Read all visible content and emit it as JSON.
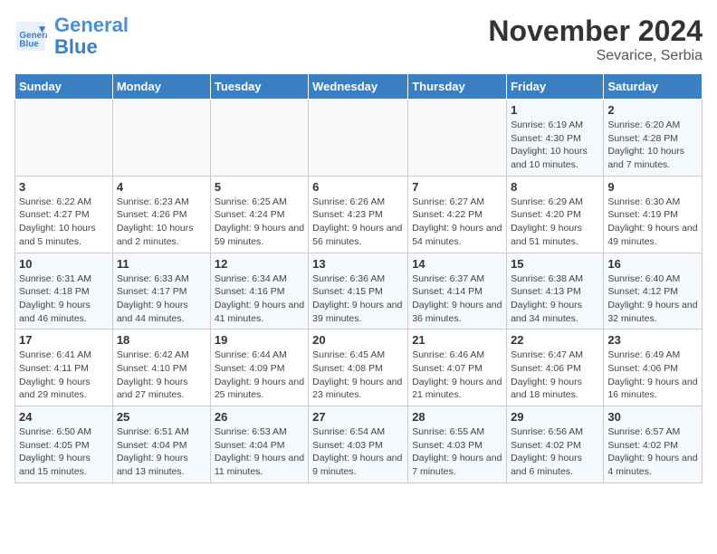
{
  "header": {
    "logo_line1": "General",
    "logo_line2": "Blue",
    "month": "November 2024",
    "location": "Sevarice, Serbia"
  },
  "weekdays": [
    "Sunday",
    "Monday",
    "Tuesday",
    "Wednesday",
    "Thursday",
    "Friday",
    "Saturday"
  ],
  "weeks": [
    [
      {
        "day": "",
        "info": ""
      },
      {
        "day": "",
        "info": ""
      },
      {
        "day": "",
        "info": ""
      },
      {
        "day": "",
        "info": ""
      },
      {
        "day": "",
        "info": ""
      },
      {
        "day": "1",
        "info": "Sunrise: 6:19 AM\nSunset: 4:30 PM\nDaylight: 10 hours and 10 minutes."
      },
      {
        "day": "2",
        "info": "Sunrise: 6:20 AM\nSunset: 4:28 PM\nDaylight: 10 hours and 7 minutes."
      }
    ],
    [
      {
        "day": "3",
        "info": "Sunrise: 6:22 AM\nSunset: 4:27 PM\nDaylight: 10 hours and 5 minutes."
      },
      {
        "day": "4",
        "info": "Sunrise: 6:23 AM\nSunset: 4:26 PM\nDaylight: 10 hours and 2 minutes."
      },
      {
        "day": "5",
        "info": "Sunrise: 6:25 AM\nSunset: 4:24 PM\nDaylight: 9 hours and 59 minutes."
      },
      {
        "day": "6",
        "info": "Sunrise: 6:26 AM\nSunset: 4:23 PM\nDaylight: 9 hours and 56 minutes."
      },
      {
        "day": "7",
        "info": "Sunrise: 6:27 AM\nSunset: 4:22 PM\nDaylight: 9 hours and 54 minutes."
      },
      {
        "day": "8",
        "info": "Sunrise: 6:29 AM\nSunset: 4:20 PM\nDaylight: 9 hours and 51 minutes."
      },
      {
        "day": "9",
        "info": "Sunrise: 6:30 AM\nSunset: 4:19 PM\nDaylight: 9 hours and 49 minutes."
      }
    ],
    [
      {
        "day": "10",
        "info": "Sunrise: 6:31 AM\nSunset: 4:18 PM\nDaylight: 9 hours and 46 minutes."
      },
      {
        "day": "11",
        "info": "Sunrise: 6:33 AM\nSunset: 4:17 PM\nDaylight: 9 hours and 44 minutes."
      },
      {
        "day": "12",
        "info": "Sunrise: 6:34 AM\nSunset: 4:16 PM\nDaylight: 9 hours and 41 minutes."
      },
      {
        "day": "13",
        "info": "Sunrise: 6:36 AM\nSunset: 4:15 PM\nDaylight: 9 hours and 39 minutes."
      },
      {
        "day": "14",
        "info": "Sunrise: 6:37 AM\nSunset: 4:14 PM\nDaylight: 9 hours and 36 minutes."
      },
      {
        "day": "15",
        "info": "Sunrise: 6:38 AM\nSunset: 4:13 PM\nDaylight: 9 hours and 34 minutes."
      },
      {
        "day": "16",
        "info": "Sunrise: 6:40 AM\nSunset: 4:12 PM\nDaylight: 9 hours and 32 minutes."
      }
    ],
    [
      {
        "day": "17",
        "info": "Sunrise: 6:41 AM\nSunset: 4:11 PM\nDaylight: 9 hours and 29 minutes."
      },
      {
        "day": "18",
        "info": "Sunrise: 6:42 AM\nSunset: 4:10 PM\nDaylight: 9 hours and 27 minutes."
      },
      {
        "day": "19",
        "info": "Sunrise: 6:44 AM\nSunset: 4:09 PM\nDaylight: 9 hours and 25 minutes."
      },
      {
        "day": "20",
        "info": "Sunrise: 6:45 AM\nSunset: 4:08 PM\nDaylight: 9 hours and 23 minutes."
      },
      {
        "day": "21",
        "info": "Sunrise: 6:46 AM\nSunset: 4:07 PM\nDaylight: 9 hours and 21 minutes."
      },
      {
        "day": "22",
        "info": "Sunrise: 6:47 AM\nSunset: 4:06 PM\nDaylight: 9 hours and 18 minutes."
      },
      {
        "day": "23",
        "info": "Sunrise: 6:49 AM\nSunset: 4:06 PM\nDaylight: 9 hours and 16 minutes."
      }
    ],
    [
      {
        "day": "24",
        "info": "Sunrise: 6:50 AM\nSunset: 4:05 PM\nDaylight: 9 hours and 15 minutes."
      },
      {
        "day": "25",
        "info": "Sunrise: 6:51 AM\nSunset: 4:04 PM\nDaylight: 9 hours and 13 minutes."
      },
      {
        "day": "26",
        "info": "Sunrise: 6:53 AM\nSunset: 4:04 PM\nDaylight: 9 hours and 11 minutes."
      },
      {
        "day": "27",
        "info": "Sunrise: 6:54 AM\nSunset: 4:03 PM\nDaylight: 9 hours and 9 minutes."
      },
      {
        "day": "28",
        "info": "Sunrise: 6:55 AM\nSunset: 4:03 PM\nDaylight: 9 hours and 7 minutes."
      },
      {
        "day": "29",
        "info": "Sunrise: 6:56 AM\nSunset: 4:02 PM\nDaylight: 9 hours and 6 minutes."
      },
      {
        "day": "30",
        "info": "Sunrise: 6:57 AM\nSunset: 4:02 PM\nDaylight: 9 hours and 4 minutes."
      }
    ]
  ]
}
